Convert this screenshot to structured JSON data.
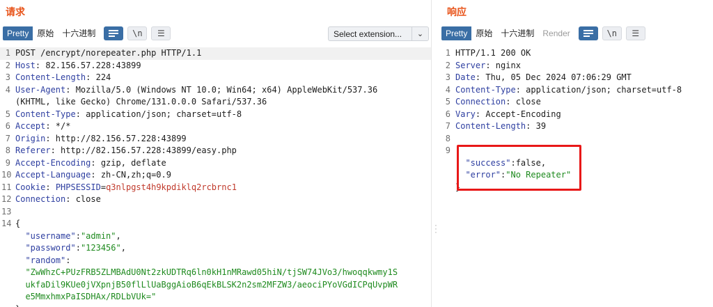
{
  "request": {
    "title": "请求",
    "tabs": [
      {
        "label": "Pretty",
        "active": true
      },
      {
        "label": "原始",
        "active": false
      },
      {
        "label": "十六进制",
        "active": false
      }
    ],
    "newline_label": "\\n",
    "select_extension": "Select extension...",
    "lines": [
      {
        "n": "1",
        "parts": [
          {
            "t": "POST /encrypt/norepeater.php HTTP/1.1",
            "c": ""
          }
        ]
      },
      {
        "n": "2",
        "parts": [
          {
            "t": "Host",
            "c": "k"
          },
          {
            "t": ": 82.156.57.228:43899",
            "c": ""
          }
        ]
      },
      {
        "n": "3",
        "parts": [
          {
            "t": "Content-Length",
            "c": "k"
          },
          {
            "t": ": 224",
            "c": ""
          }
        ]
      },
      {
        "n": "4",
        "parts": [
          {
            "t": "User-Agent",
            "c": "k"
          },
          {
            "t": ": Mozilla/5.0 (Windows NT 10.0; Win64; x64) AppleWebKit/537.36",
            "c": ""
          }
        ]
      },
      {
        "n": "",
        "parts": [
          {
            "t": "(KHTML, like Gecko) Chrome/131.0.0.0 Safari/537.36",
            "c": ""
          }
        ]
      },
      {
        "n": "5",
        "parts": [
          {
            "t": "Content-Type",
            "c": "k"
          },
          {
            "t": ": application/json; charset=utf-8",
            "c": ""
          }
        ]
      },
      {
        "n": "6",
        "parts": [
          {
            "t": "Accept",
            "c": "k"
          },
          {
            "t": ": */*",
            "c": ""
          }
        ]
      },
      {
        "n": "7",
        "parts": [
          {
            "t": "Origin",
            "c": "k"
          },
          {
            "t": ": http://82.156.57.228:43899",
            "c": ""
          }
        ]
      },
      {
        "n": "8",
        "parts": [
          {
            "t": "Referer",
            "c": "k"
          },
          {
            "t": ": http://82.156.57.228:43899/easy.php",
            "c": ""
          }
        ]
      },
      {
        "n": "9",
        "parts": [
          {
            "t": "Accept-Encoding",
            "c": "k"
          },
          {
            "t": ": gzip, deflate",
            "c": ""
          }
        ]
      },
      {
        "n": "10",
        "parts": [
          {
            "t": "Accept-Language",
            "c": "k"
          },
          {
            "t": ": zh-CN,zh;q=0.9",
            "c": ""
          }
        ]
      },
      {
        "n": "11",
        "parts": [
          {
            "t": "Cookie",
            "c": "k"
          },
          {
            "t": ": ",
            "c": ""
          },
          {
            "t": "PHPSESSID",
            "c": "k"
          },
          {
            "t": "=",
            "c": ""
          },
          {
            "t": "q3nlpgst4h9kpdiklq2rcbrnc1",
            "c": "v"
          }
        ]
      },
      {
        "n": "12",
        "parts": [
          {
            "t": "Connection",
            "c": "k"
          },
          {
            "t": ": close",
            "c": ""
          }
        ]
      },
      {
        "n": "13",
        "parts": [
          {
            "t": "",
            "c": ""
          }
        ]
      },
      {
        "n": "14",
        "parts": [
          {
            "t": "{",
            "c": ""
          }
        ]
      },
      {
        "n": "",
        "parts": [
          {
            "t": "  ",
            "c": ""
          },
          {
            "t": "\"username\"",
            "c": "k"
          },
          {
            "t": ":",
            "c": ""
          },
          {
            "t": "\"admin\"",
            "c": "s"
          },
          {
            "t": ",",
            "c": ""
          }
        ]
      },
      {
        "n": "",
        "parts": [
          {
            "t": "  ",
            "c": ""
          },
          {
            "t": "\"password\"",
            "c": "k"
          },
          {
            "t": ":",
            "c": ""
          },
          {
            "t": "\"123456\"",
            "c": "s"
          },
          {
            "t": ",",
            "c": ""
          }
        ]
      },
      {
        "n": "",
        "parts": [
          {
            "t": "  ",
            "c": ""
          },
          {
            "t": "\"random\"",
            "c": "k"
          },
          {
            "t": ":",
            "c": ""
          }
        ]
      },
      {
        "n": "",
        "parts": [
          {
            "t": "  ",
            "c": ""
          },
          {
            "t": "\"ZwWhzC+PUzFRB5ZLMBAdU0Nt2zkUDTRq6ln0kH1nMRawd05hiN/tjSW74JVo3/hwoqqkwmy1S",
            "c": "s"
          }
        ]
      },
      {
        "n": "",
        "parts": [
          {
            "t": "  ",
            "c": ""
          },
          {
            "t": "ukfaDil9KUe0jVXpnjB50flLlUaBggAioB6qEkBLSK2n2sm2MFZW3/aeociPYoVGdICPqUvpWR",
            "c": "s"
          }
        ]
      },
      {
        "n": "",
        "parts": [
          {
            "t": "  ",
            "c": ""
          },
          {
            "t": "e5MmxhmxPaISDHAx/RDLbVUk=\"",
            "c": "s"
          }
        ]
      },
      {
        "n": "",
        "parts": [
          {
            "t": "}",
            "c": ""
          }
        ]
      }
    ]
  },
  "response": {
    "title": "响应",
    "tabs": [
      {
        "label": "Pretty",
        "active": true
      },
      {
        "label": "原始",
        "active": false
      },
      {
        "label": "十六进制",
        "active": false
      },
      {
        "label": "Render",
        "active": false,
        "disabled": true
      }
    ],
    "newline_label": "\\n",
    "lines": [
      {
        "n": "1",
        "parts": [
          {
            "t": "HTTP/1.1 200 OK",
            "c": ""
          }
        ]
      },
      {
        "n": "2",
        "parts": [
          {
            "t": "Server",
            "c": "k"
          },
          {
            "t": ": nginx",
            "c": ""
          }
        ]
      },
      {
        "n": "3",
        "parts": [
          {
            "t": "Date",
            "c": "k"
          },
          {
            "t": ": Thu, 05 Dec 2024 07:06:29 GMT",
            "c": ""
          }
        ]
      },
      {
        "n": "4",
        "parts": [
          {
            "t": "Content-Type",
            "c": "k"
          },
          {
            "t": ": application/json; charset=utf-8",
            "c": ""
          }
        ]
      },
      {
        "n": "5",
        "parts": [
          {
            "t": "Connection",
            "c": "k"
          },
          {
            "t": ": close",
            "c": ""
          }
        ]
      },
      {
        "n": "6",
        "parts": [
          {
            "t": "Vary",
            "c": "k"
          },
          {
            "t": ": Accept-Encoding",
            "c": ""
          }
        ]
      },
      {
        "n": "7",
        "parts": [
          {
            "t": "Content-Length",
            "c": "k"
          },
          {
            "t": ": 39",
            "c": ""
          }
        ]
      },
      {
        "n": "8",
        "parts": [
          {
            "t": "",
            "c": ""
          }
        ]
      },
      {
        "n": "9",
        "parts": [
          {
            "t": "",
            "c": ""
          }
        ]
      },
      {
        "n": "",
        "parts": [
          {
            "t": "  ",
            "c": ""
          },
          {
            "t": "\"success\"",
            "c": "k"
          },
          {
            "t": ":false,",
            "c": ""
          }
        ]
      },
      {
        "n": "",
        "parts": [
          {
            "t": "  ",
            "c": ""
          },
          {
            "t": "\"error\"",
            "c": "k"
          },
          {
            "t": ":",
            "c": ""
          },
          {
            "t": "\"No Repeater\"",
            "c": "s"
          }
        ]
      },
      {
        "n": "",
        "parts": [
          {
            "t": "}",
            "c": ""
          }
        ]
      }
    ]
  },
  "colors": {
    "title": "#e8541a",
    "active_tab": "#3a6ea5",
    "key": "#2d3ea0",
    "string": "#1e8a1e",
    "cookie_value": "#c0392b",
    "highlight_box": "#e81818"
  }
}
